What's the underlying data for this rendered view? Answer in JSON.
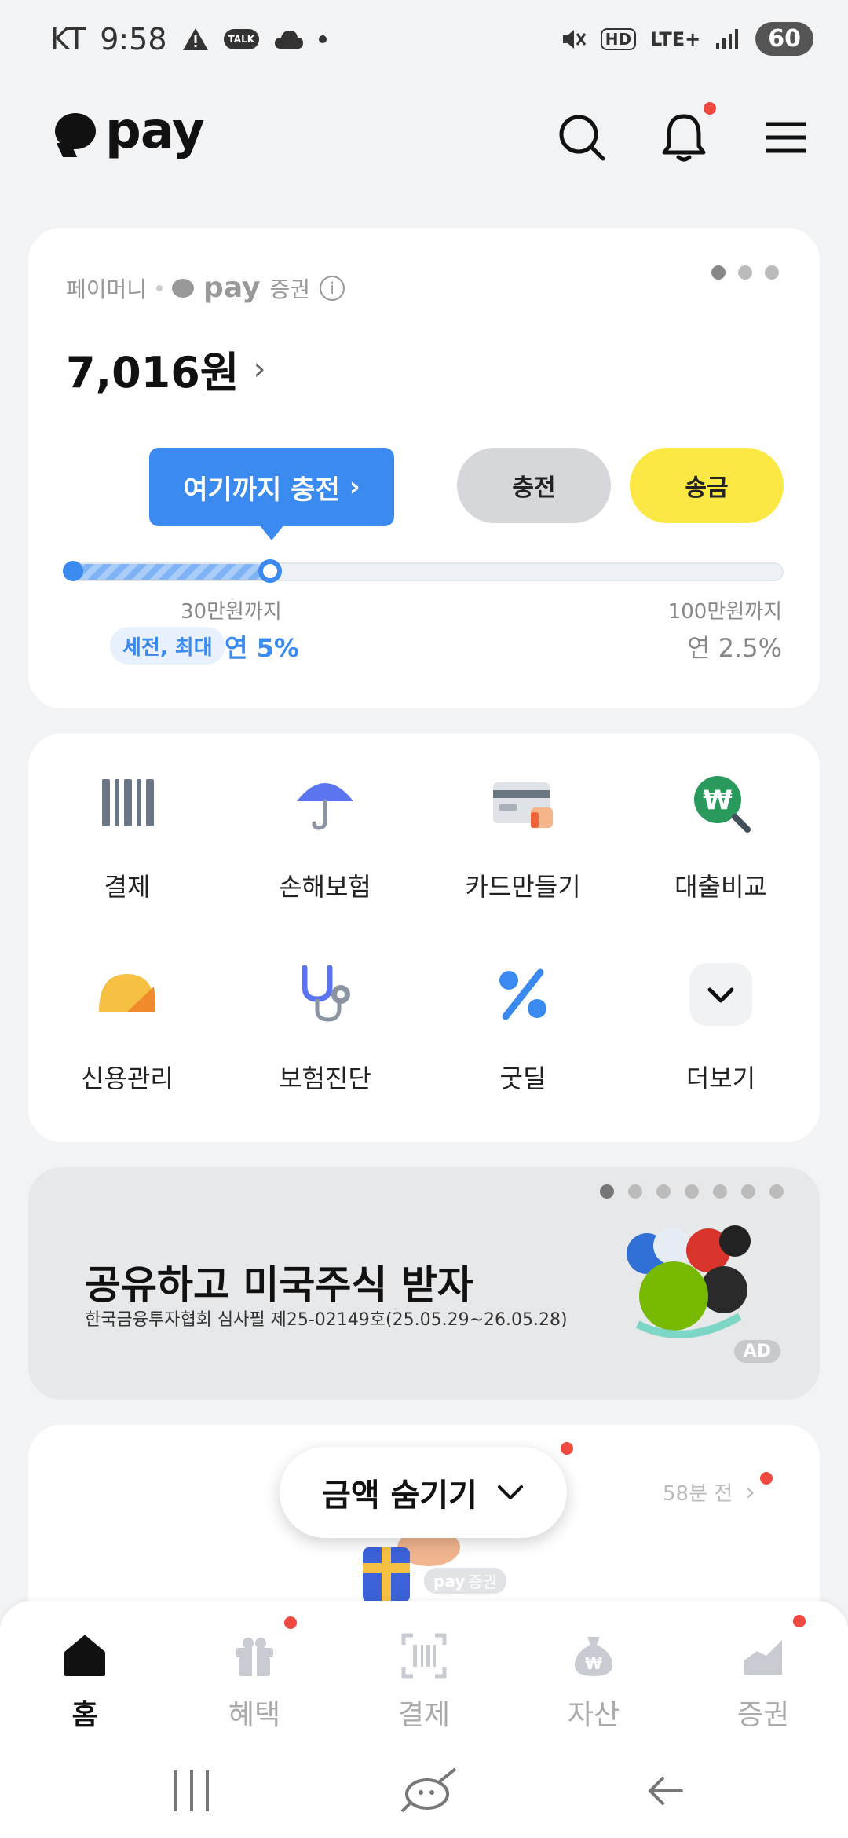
{
  "status_bar": {
    "carrier": "KT",
    "time": "9:58",
    "talk_label": "TALK",
    "network": "LTE+",
    "hd": "HD",
    "battery": "60"
  },
  "header": {
    "logo_text": "pay"
  },
  "balance": {
    "source_label": "페이머니",
    "pay_label": "pay",
    "securities_label": "증권",
    "amount": "7,016원",
    "tooltip": "여기까지 충전",
    "charge_button": "충전",
    "send_button": "송금",
    "progress_fraction": 0.28,
    "tier1_label": "30만원까지",
    "tier2_label": "100만원까지",
    "chip_label": "세전, 최대",
    "tier1_rate": "연 5%",
    "tier2_rate": "연 2.5%"
  },
  "menu": [
    {
      "label": "결제",
      "icon": "barcode-icon"
    },
    {
      "label": "손해보험",
      "icon": "umbrella-icon"
    },
    {
      "label": "카드만들기",
      "icon": "card-icon"
    },
    {
      "label": "대출비교",
      "icon": "loan-search-icon"
    },
    {
      "label": "신용관리",
      "icon": "credit-gauge-icon"
    },
    {
      "label": "보험진단",
      "icon": "stethoscope-icon"
    },
    {
      "label": "굿딜",
      "icon": "percent-icon"
    },
    {
      "label": "더보기",
      "icon": "chevron-down-icon"
    }
  ],
  "ad": {
    "title": "공유하고 미국주식 받자",
    "subtitle": "한국금융투자협회 심사필 제25-02149호(25.05.29~26.05.28)",
    "badge": "AD"
  },
  "bottom_card": {
    "hide_button": "금액 숨기기",
    "time_ago": "58분 전",
    "brand_pay": "pay",
    "brand_securities": "증권"
  },
  "tabs": [
    {
      "label": "홈",
      "active": true
    },
    {
      "label": "혜택"
    },
    {
      "label": "결제"
    },
    {
      "label": "자산"
    },
    {
      "label": "증권"
    }
  ],
  "colors": {
    "accent_blue": "#3b8af0",
    "accent_yellow": "#fbe845",
    "notification_red": "#f04a40"
  }
}
